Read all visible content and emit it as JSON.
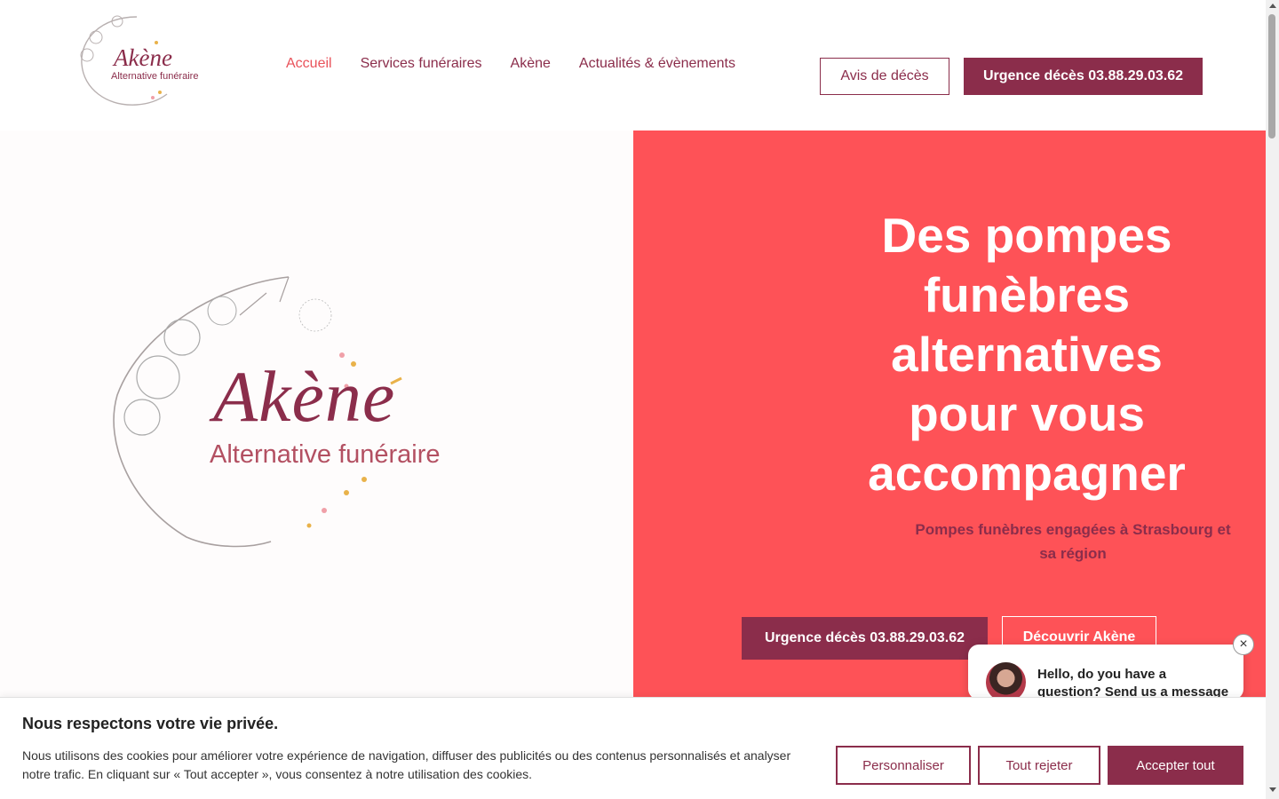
{
  "header": {
    "logo": {
      "word": "Akène",
      "sub": "Alternative funéraire"
    },
    "nav": [
      {
        "label": "Accueil",
        "active": true
      },
      {
        "label": "Services funéraires"
      },
      {
        "label": "Akène"
      },
      {
        "label": "Actualités & évènements"
      }
    ],
    "avis_label": "Avis de décès",
    "urgence_label": "Urgence décès 03.88.29.03.62"
  },
  "hero": {
    "logo": {
      "word": "Akène",
      "sub": "Alternative funéraire"
    },
    "title": "Des pompes funèbres alternatives pour vous accompagner",
    "subtitle": "Pompes funèbres engagées à Strasbourg et sa région",
    "primary_button": "Urgence décès 03.88.29.03.62",
    "secondary_button": "Découvrir Akène"
  },
  "chat": {
    "message": "Hello, do you have a question? Send us a message here.",
    "close_icon": "close-icon"
  },
  "cookie": {
    "title": "Nous respectons votre vie privée.",
    "text": "Nous utilisons des cookies pour améliorer votre expérience de navigation, diffuser des publicités ou des contenus personnalisés et analyser notre trafic. En cliquant sur « Tout accepter », vous consentez à notre utilisation des cookies.",
    "customize": "Personnaliser",
    "reject": "Tout rejeter",
    "accept": "Accepter tout"
  },
  "colors": {
    "accent": "#8b2d4b",
    "hero_bg": "#fe5257",
    "active_nav": "#e9525a"
  }
}
